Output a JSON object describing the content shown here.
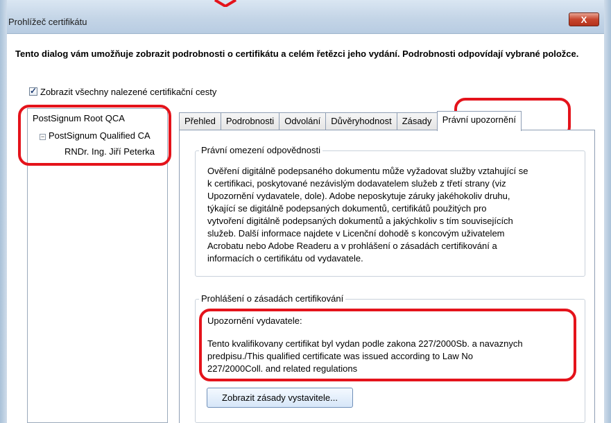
{
  "window": {
    "title": "Prohlížeč certifikátu",
    "close_glyph": "X"
  },
  "intro_text": "Tento dialog vám umožňuje zobrazit podrobnosti o certifikátu a celém řetězci jeho vydání. Podrobnosti odpovídají vybrané položce.",
  "show_all_paths": {
    "label": "Zobrazit všechny nalezené certifikační cesty",
    "checked": true
  },
  "tree": {
    "items": [
      {
        "label": "PostSignum Root QCA"
      },
      {
        "label": "PostSignum Qualified CA"
      },
      {
        "label": "RNDr. Ing. Jiří Peterka"
      }
    ],
    "expander": "−"
  },
  "tabs": [
    {
      "label": "Přehled"
    },
    {
      "label": "Podrobnosti"
    },
    {
      "label": "Odvolání"
    },
    {
      "label": "Důvěryhodnost"
    },
    {
      "label": "Zásady"
    },
    {
      "label": "Právní upozornění"
    }
  ],
  "legal": {
    "group_title": "Právní omezení odpovědnosti",
    "lines": [
      "Ověření digitálně podepsaného dokumentu může vyžadovat služby vztahující se",
      "k certifikaci, poskytované nezávislým dodavatelem služeb z třetí strany (viz",
      "Upozornění vydavatele, dole). Adobe neposkytuje záruky jakéhokoliv druhu,",
      "týkající se digitálně podepsaných dokumentů, certifikátů použitých pro",
      "vytvoření digitálně podepsaných dokumentů a jakýchkoliv s tím souvisejících",
      "služeb. Další informace najdete v Licenční dohodě s koncovým uživatelem",
      "Acrobatu nebo Adobe Readeru a v prohlášení o zásadách certifikování a",
      "informacích o certifikátu od vydavatele."
    ]
  },
  "policy": {
    "group_title": "Prohlášení o zásadách certifikování",
    "notice_heading": "Upozornění vydavatele:",
    "notice_lines": [
      "Tento kvalifikovany certifikat byl vydan podle zakona 227/2000Sb. a navaznych",
      "predpisu./This qualified certificate was issued according to Law No",
      "227/2000Coll. and related regulations"
    ],
    "button_label": "Zobrazit zásady vystavitele..."
  },
  "colors": {
    "highlight": "#e4131b",
    "titlebar": "#c4d5e7",
    "close_button": "#c7452d"
  }
}
